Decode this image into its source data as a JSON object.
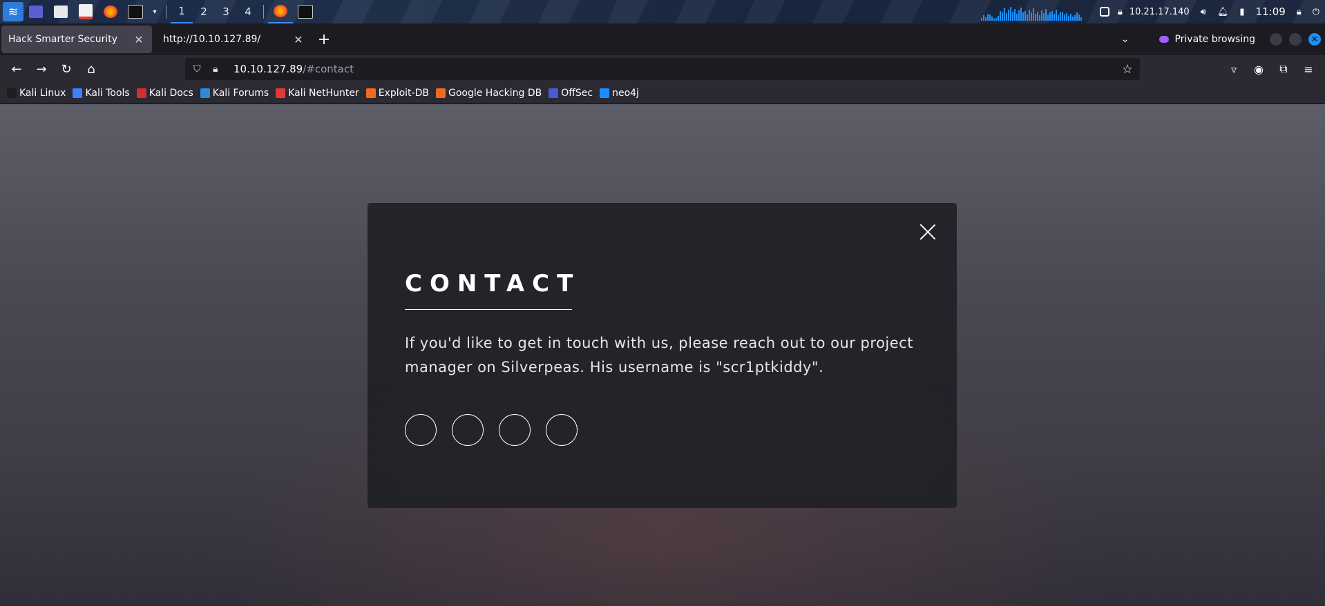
{
  "panel": {
    "workspaces": [
      "1",
      "2",
      "3",
      "4"
    ],
    "ip": "10.21.17.140",
    "clock": "11:09"
  },
  "browser": {
    "tabs": [
      {
        "title": "Hack Smarter Security",
        "active": true
      },
      {
        "title": "http://10.10.127.89/",
        "active": false
      }
    ],
    "private_label": "Private browsing",
    "url_host": "10.10.127.89",
    "url_path": "/#contact",
    "bookmarks": [
      {
        "label": "Kali Linux",
        "color": "#1d1d1d"
      },
      {
        "label": "Kali Tools",
        "color": "#3b82f6"
      },
      {
        "label": "Kali Docs",
        "color": "#d32f2f"
      },
      {
        "label": "Kali Forums",
        "color": "#2c8bd8"
      },
      {
        "label": "Kali NetHunter",
        "color": "#e53935"
      },
      {
        "label": "Exploit-DB",
        "color": "#f26b1d"
      },
      {
        "label": "Google Hacking DB",
        "color": "#f26b1d"
      },
      {
        "label": "OffSec",
        "color": "#4a5bd6"
      },
      {
        "label": "neo4j",
        "color": "#1a8fff"
      }
    ]
  },
  "contact": {
    "heading": "CONTACT",
    "body": "If you'd like to get in touch with us, please reach out to our project manager on Silverpeas. His username is \"scr1ptkiddy\"."
  },
  "colors": {
    "accent": "#1a8fff",
    "modal_bg": "#202126"
  }
}
